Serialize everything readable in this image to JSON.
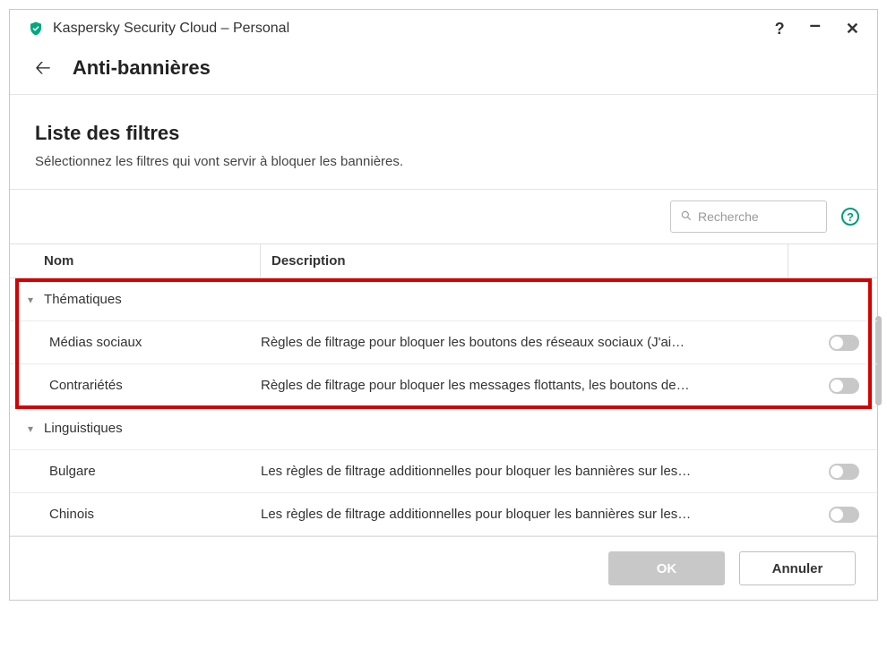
{
  "window": {
    "title": "Kaspersky Security Cloud – Personal"
  },
  "subheader": {
    "title": "Anti-bannières"
  },
  "section": {
    "heading": "Liste des filtres",
    "description": "Sélectionnez les filtres qui vont servir à bloquer les bannières."
  },
  "search": {
    "placeholder": "Recherche"
  },
  "columns": {
    "name": "Nom",
    "description": "Description"
  },
  "groups": [
    {
      "label": "Thématiques",
      "items": [
        {
          "name": "Médias sociaux",
          "desc": "Règles de filtrage pour bloquer les boutons des réseaux sociaux (J'ai…"
        },
        {
          "name": "Contrariétés",
          "desc": "Règles de filtrage pour bloquer les messages flottants, les boutons de…"
        }
      ]
    },
    {
      "label": "Linguistiques",
      "items": [
        {
          "name": "Bulgare",
          "desc": "Les règles de filtrage additionnelles pour bloquer les bannières sur les…"
        },
        {
          "name": "Chinois",
          "desc": "Les règles de filtrage additionnelles pour bloquer les bannières sur les…"
        }
      ]
    }
  ],
  "footer": {
    "ok": "OK",
    "cancel": "Annuler"
  },
  "help_glyph": "?"
}
